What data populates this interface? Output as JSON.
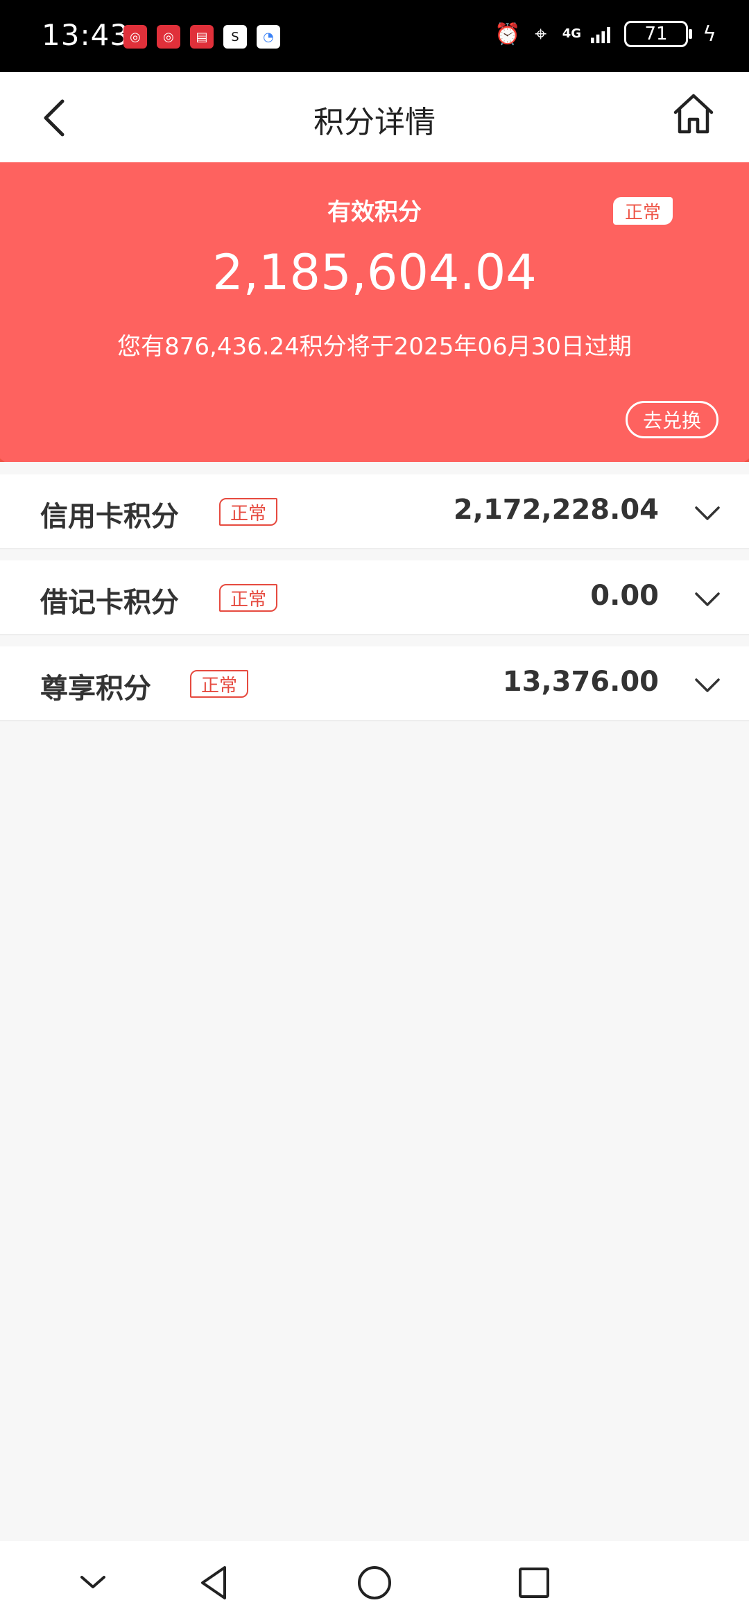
{
  "status_bar": {
    "time": "13:43",
    "battery": "71",
    "network": "4G",
    "apps": [
      {
        "name": "bank-of-china-icon",
        "color": "#e0303a"
      },
      {
        "name": "boc-life-icon",
        "color": "#e0303a"
      },
      {
        "name": "yunshanfu-icon",
        "color": "#e0303a"
      },
      {
        "name": "sf-express-icon",
        "color": "#ffffff"
      },
      {
        "name": "search-app-icon",
        "color": "#3b82f6"
      }
    ]
  },
  "header": {
    "title": "积分详情"
  },
  "banner": {
    "label": "有效积分",
    "badge": "正常",
    "total_points": "2,185,604.04",
    "expiry_note": "您有876,436.24积分将于2025年06月30日过期",
    "redeem_button": "去兑换",
    "colors": {
      "primary": "#fe625f",
      "secondary": "#ee5446"
    }
  },
  "points_list": [
    {
      "name": "信用卡积分",
      "status": "正常",
      "value": "2,172,228.04"
    },
    {
      "name": "借记卡积分",
      "status": "正常",
      "value": "0.00"
    },
    {
      "name": "尊享积分",
      "status": "正常",
      "value": "13,376.00"
    }
  ]
}
